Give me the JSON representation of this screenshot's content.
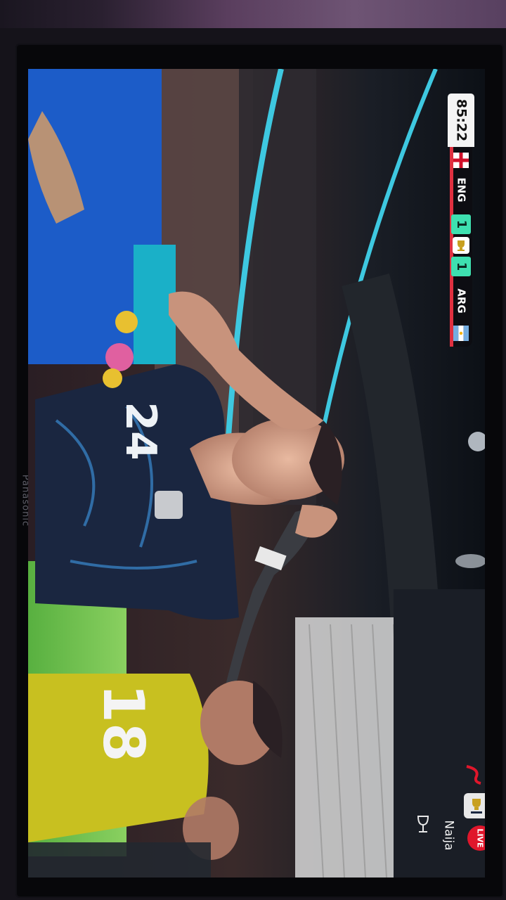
{
  "tv": {
    "brand": "Panasonic"
  },
  "scorebug": {
    "clock": "85:22",
    "home_team": "ENG",
    "home_score": "1",
    "away_score": "1",
    "away_team": "ARG",
    "score_color": "#3ee0b0"
  },
  "broadcast": {
    "live_label": "LIVE",
    "channel_name": "Naija",
    "live_color": "#e0162b"
  },
  "players": {
    "main_player_number": "24",
    "other_player_number": "18"
  },
  "icons": [
    "england-flag-icon",
    "argentina-flag-icon",
    "trophy-icon",
    "live-badge-icon",
    "channel-logo-icon",
    "wine-glass-icon"
  ]
}
